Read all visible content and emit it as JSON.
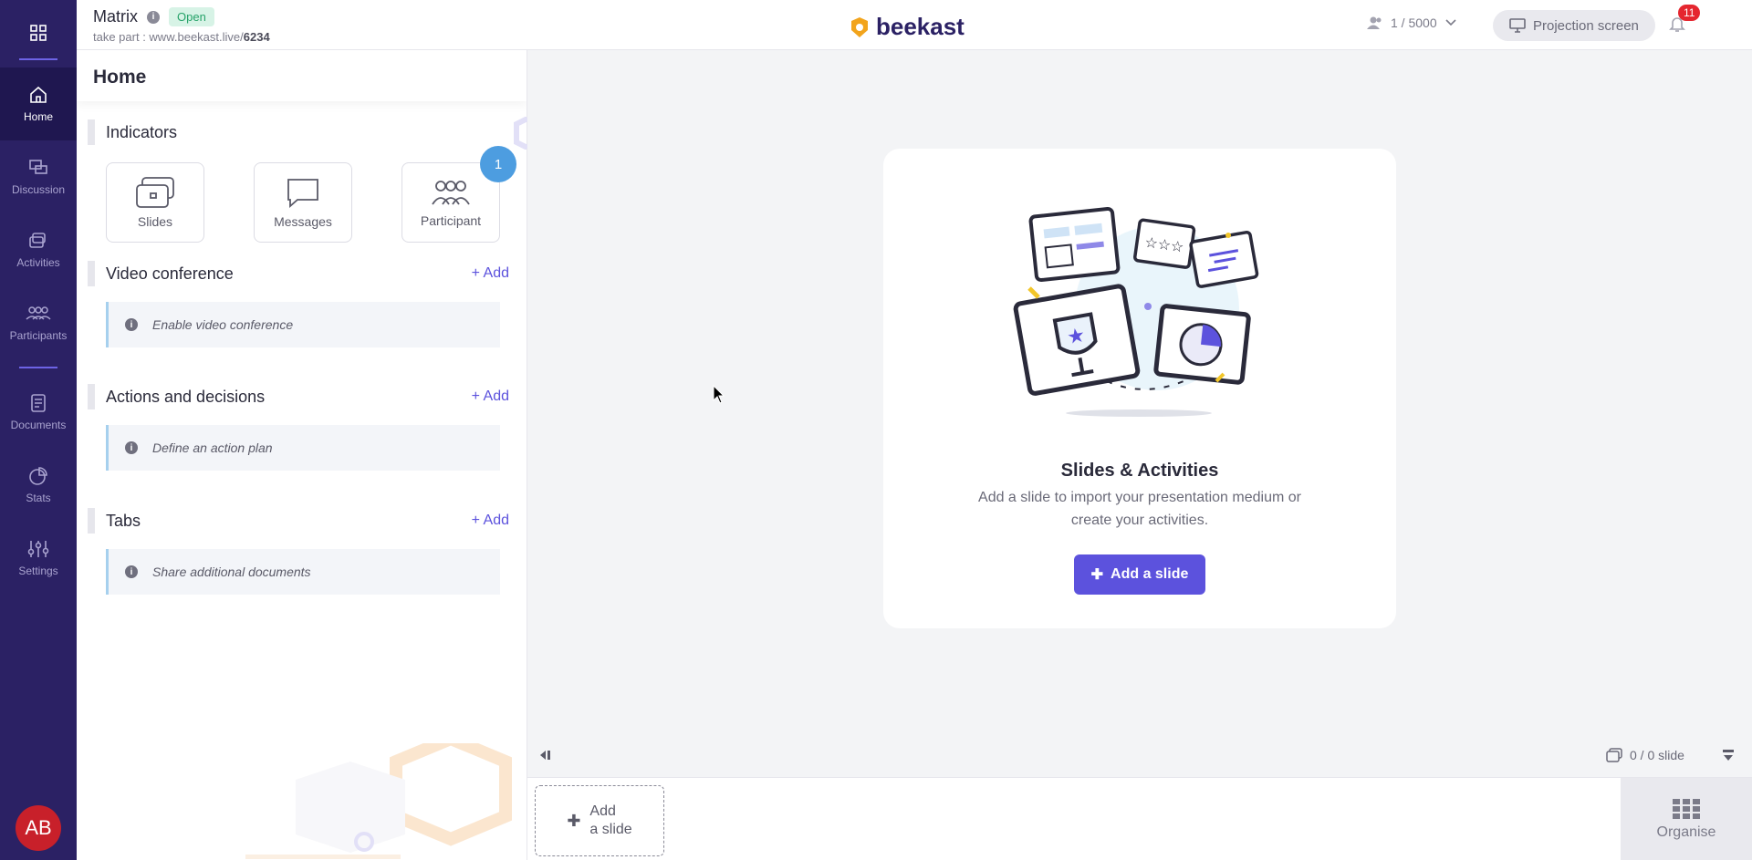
{
  "header": {
    "title": "Matrix",
    "status": "Open",
    "takepart_prefix": "take part : www.beekast.live/",
    "takepart_code": "6234",
    "logo_text": "beekast",
    "participants": "1 / 5000",
    "projection_label": "Projection screen",
    "notifications": "11"
  },
  "nav": {
    "items": [
      {
        "label": "Home",
        "icon": "home-icon"
      },
      {
        "label": "Discussion",
        "icon": "discussion-icon"
      },
      {
        "label": "Activities",
        "icon": "activities-icon"
      },
      {
        "label": "Participants",
        "icon": "participants-icon"
      },
      {
        "label": "Documents",
        "icon": "documents-icon"
      },
      {
        "label": "Stats",
        "icon": "stats-icon"
      },
      {
        "label": "Settings",
        "icon": "settings-icon"
      }
    ],
    "avatar": "AB"
  },
  "panel": {
    "title": "Home",
    "indicators": {
      "title": "Indicators",
      "tiles": [
        "Slides",
        "Messages",
        "Participant"
      ],
      "participant_count": "1"
    },
    "video": {
      "title": "Video conference",
      "add": "+ Add",
      "info": "Enable video conference"
    },
    "actions": {
      "title": "Actions and decisions",
      "add": "+ Add",
      "info": "Define an action plan"
    },
    "tabs": {
      "title": "Tabs",
      "add": "+ Add",
      "info": "Share additional documents"
    }
  },
  "main": {
    "card_title": "Slides & Activities",
    "card_desc": "Add a slide to import your presentation medium or create your activities.",
    "add_button": "Add a slide",
    "slide_count": "0 / 0 slide"
  },
  "bottom": {
    "add_line1": "Add",
    "add_line2": "a slide",
    "organise": "Organise"
  },
  "colors": {
    "nav_bg": "#2b2164",
    "accent": "#5c52dd",
    "notif": "#e5262f",
    "open_badge": "#27a36a"
  }
}
